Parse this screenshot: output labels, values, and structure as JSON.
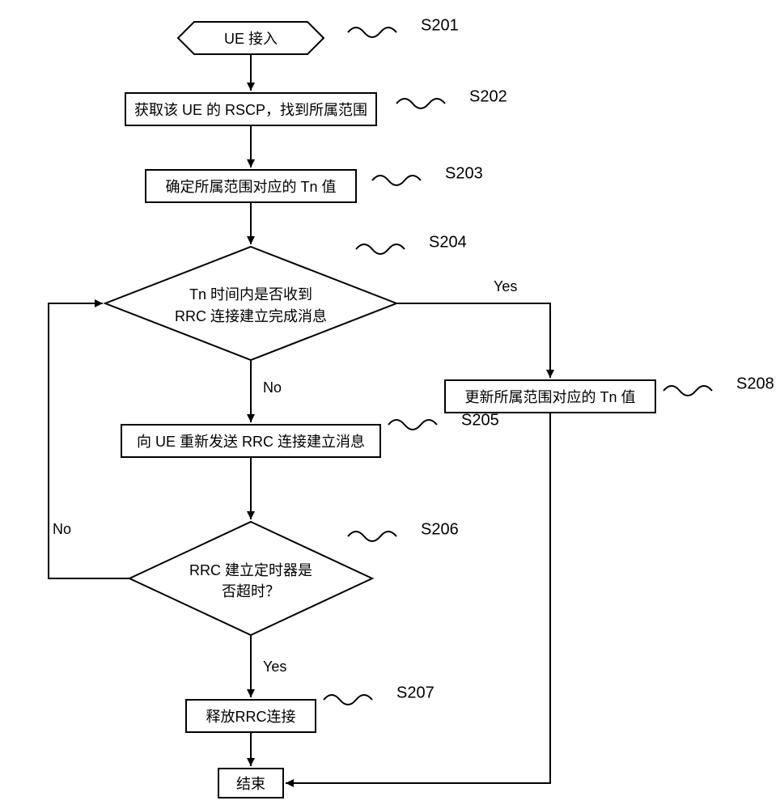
{
  "nodes": {
    "s201": {
      "label": "S201",
      "text": "UE 接入"
    },
    "s202": {
      "label": "S202",
      "text": "获取该 UE 的 RSCP，找到所属范围"
    },
    "s203": {
      "label": "S203",
      "text": "确定所属范围对应的 Tn 值"
    },
    "s204": {
      "label": "S204",
      "line1": "Tn  时间内是否收到",
      "line2": "RRC 连接建立完成消息"
    },
    "s205": {
      "label": "S205",
      "text": "向 UE 重新发送 RRC 连接建立消息"
    },
    "s206": {
      "label": "S206",
      "line1": "RRC 建立定时器是",
      "line2": "否超时？"
    },
    "s207": {
      "label": "S207",
      "text": "释放RRC连接"
    },
    "s208": {
      "label": "S208",
      "text": "更新所属范围对应的 Tn 值"
    },
    "end": {
      "text": "结束"
    }
  },
  "edges": {
    "yes1": "Yes",
    "no1": "No",
    "yes2": "Yes",
    "no2": "No"
  }
}
